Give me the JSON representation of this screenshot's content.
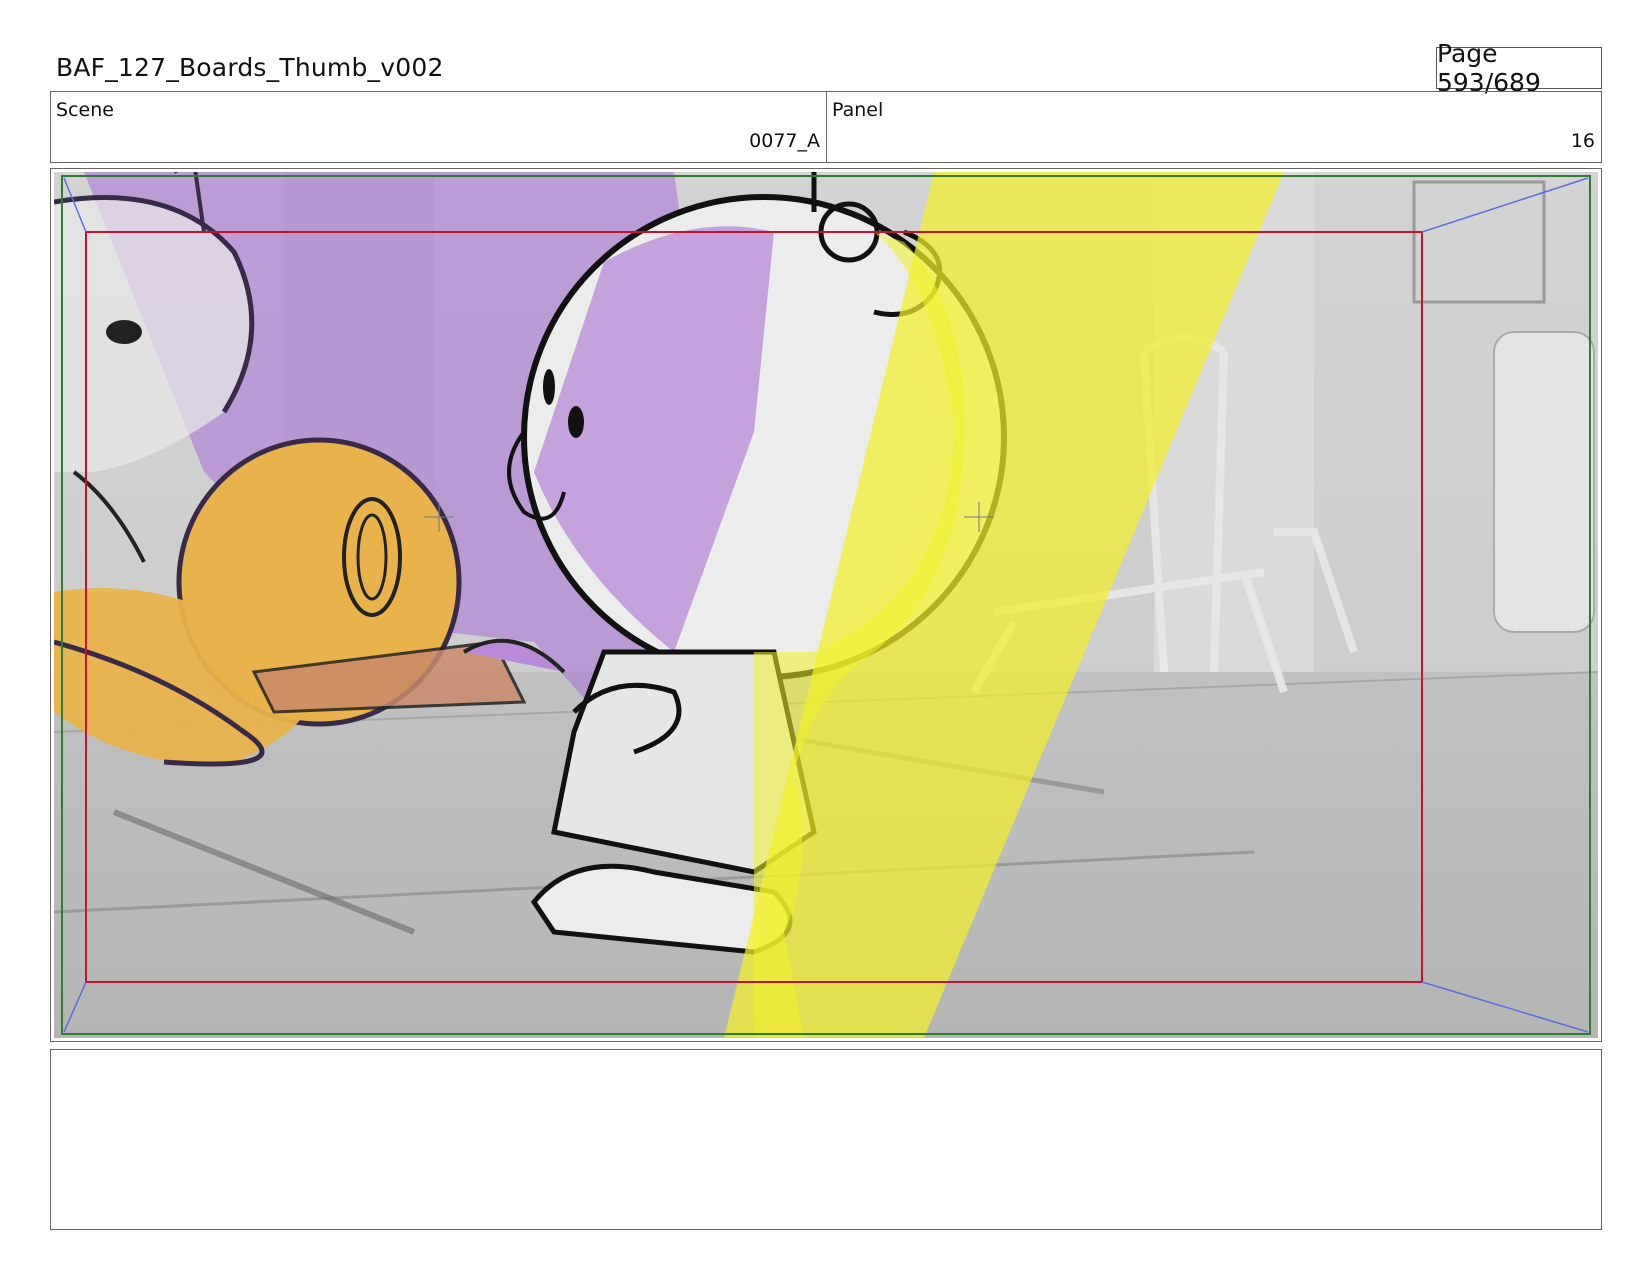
{
  "header": {
    "document_title": "BAF_127_Boards_Thumb_v002",
    "page_label": "Page 593/689"
  },
  "info": {
    "scene_label": "Scene",
    "scene_value": "0077_A",
    "panel_label": "Panel",
    "panel_value": "16"
  },
  "colors": {
    "safe_frame": "#c8102e",
    "camera_frame": "#2e7d32",
    "purple_tone": "#b48ed6",
    "orange_tone": "#e8b34a",
    "yellow_light": "#f2f02a"
  },
  "notes": {
    "text": ""
  }
}
